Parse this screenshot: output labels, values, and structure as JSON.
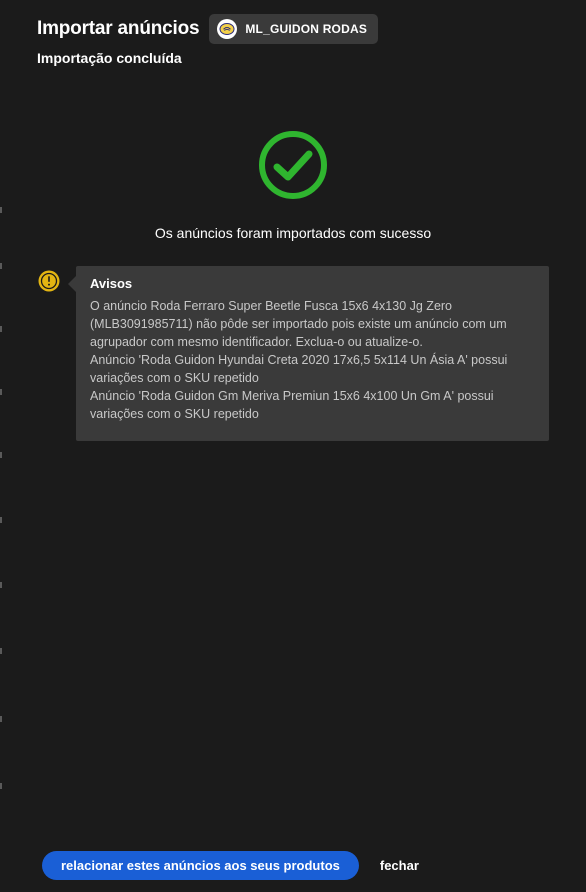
{
  "header": {
    "title": "Importar anúncios",
    "subtitle": "Importação concluída",
    "account": {
      "name": "ML_GUIDON RODAS",
      "logo_icon": "account-logo-icon"
    }
  },
  "result": {
    "status_icon": "check-circle-icon",
    "status_color": "#2fb52f",
    "message": "Os anúncios foram importados com sucesso"
  },
  "warnings": {
    "icon": "warning-icon",
    "icon_color": "#e3b512",
    "title": "Avisos",
    "messages": [
      "O anúncio Roda Ferraro Super Beetle Fusca 15x6 4x130 Jg Zero (MLB3091985711) não pôde ser importado pois existe um anúncio com um agrupador com mesmo identificador. Exclua-o ou atualize-o.",
      "Anúncio 'Roda Guidon Hyundai Creta 2020 17x6,5 5x114 Un Ásia A' possui variações com o SKU repetido",
      "Anúncio 'Roda Guidon Gm Meriva Premiun 15x6 4x100 Un Gm A' possui variações com o SKU repetido"
    ]
  },
  "actions": {
    "relate_label": "relacionar estes anúncios aos seus produtos",
    "close_label": "fechar"
  },
  "colors": {
    "background": "#1b1b1b",
    "panel": "#3a3a3a",
    "primary": "#1a5fd6"
  }
}
